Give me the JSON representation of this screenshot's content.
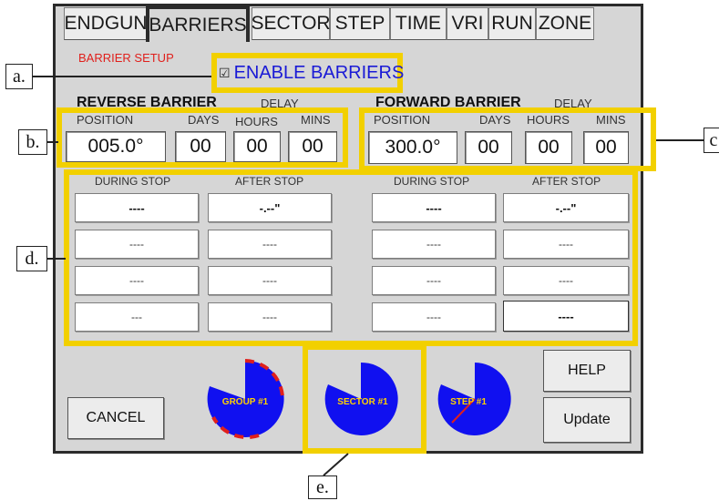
{
  "tabs": [
    "ENDGUN",
    "BARRIERS",
    "SECTOR",
    "STEP",
    "TIME",
    "VRI",
    "RUN",
    "ZONE"
  ],
  "setup_title": "BARRIER SETUP",
  "enable_checkbox_glyph": "☑",
  "enable_label": "ENABLE BARRIERS",
  "reverse": {
    "title": "REVERSE BARRIER",
    "delay_label": "DELAY",
    "position_label": "POSITION",
    "days_label": "DAYS",
    "hours_label": "HOURS",
    "mins_label": "MINS",
    "position": "005.0°",
    "days": "00",
    "hours": "00",
    "mins": "00",
    "during_stop_label": "DURING STOP",
    "after_stop_label": "AFTER STOP",
    "during_stop": [
      "----",
      "----",
      "----",
      "---"
    ],
    "after_stop": [
      "-.--\"",
      "----",
      "----",
      "----"
    ]
  },
  "forward": {
    "title": "FORWARD BARRIER",
    "delay_label": "DELAY",
    "position_label": "POSITION",
    "days_label": "DAYS",
    "hours_label": "HOURS",
    "mins_label": "MINS",
    "position": "300.0°",
    "days": "00",
    "hours": "00",
    "mins": "00",
    "during_stop_label": "DURING STOP",
    "after_stop_label": "AFTER STOP",
    "during_stop": [
      "----",
      "----",
      "----",
      "----"
    ],
    "after_stop": [
      "-.--\"",
      "----",
      "----",
      "----"
    ]
  },
  "buttons": {
    "cancel": "CANCEL",
    "help": "HELP",
    "update": "Update"
  },
  "dials": [
    {
      "label": "GROUP #1"
    },
    {
      "label": "SECTOR #1"
    },
    {
      "label": "STEP #1"
    }
  ],
  "callouts": [
    "a.",
    "b.",
    "c",
    "d.",
    "e."
  ],
  "colors": {
    "setup_title": "#e0201c",
    "enable_label": "#1a1ad6",
    "highlight": "#f2d000",
    "dial_fill": "#1010f0",
    "dial_text": "#ffd200",
    "dial_marker": "#e0201c",
    "panel": "#d6d6d6"
  }
}
